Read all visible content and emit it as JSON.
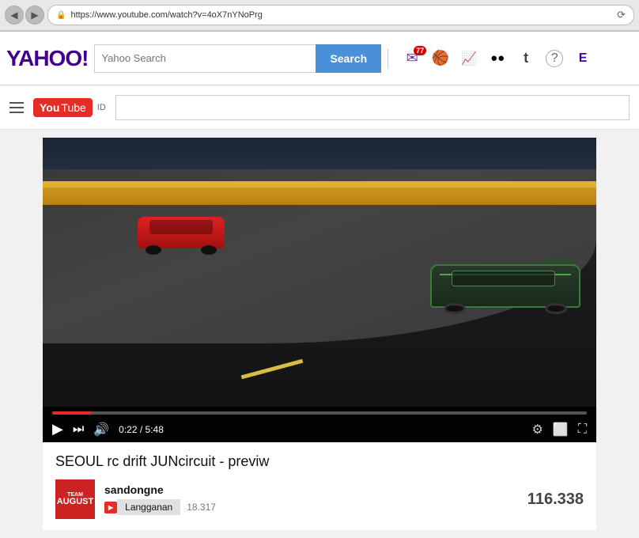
{
  "browser": {
    "url": "https://www.youtube.com/watch?v=4oX7nYNoPrg",
    "back_icon": "◀",
    "forward_icon": "▶",
    "refresh_icon": "↻",
    "lock_icon": "🔒"
  },
  "yahoo_bar": {
    "logo": "YAHOO!",
    "search_placeholder": "Yahoo Search",
    "search_button_label": "Search",
    "mail_badge": "77",
    "divider_symbol": "|"
  },
  "youtube_bar": {
    "logo_you": "You",
    "logo_tube": "Tube",
    "locale": "ID",
    "search_placeholder": ""
  },
  "video": {
    "current_time": "0:22",
    "duration": "5:48",
    "time_display": "0:22 / 5:48",
    "progress_percent": 7.3,
    "title": "SEOUL rc drift JUNcircuit - previw",
    "channel_name": "sandongne",
    "avatar_line1": "TEAM",
    "avatar_line2": "AUGUST",
    "subscribe_label": "Langganan",
    "subscriber_count": "18.317",
    "view_count": "116.338"
  },
  "controls": {
    "play_icon": "▶",
    "skip_icon": "⏭",
    "volume_icon": "🔊",
    "settings_icon": "⚙",
    "theater_icon": "⬜",
    "fullscreen_icon": "⛶"
  }
}
